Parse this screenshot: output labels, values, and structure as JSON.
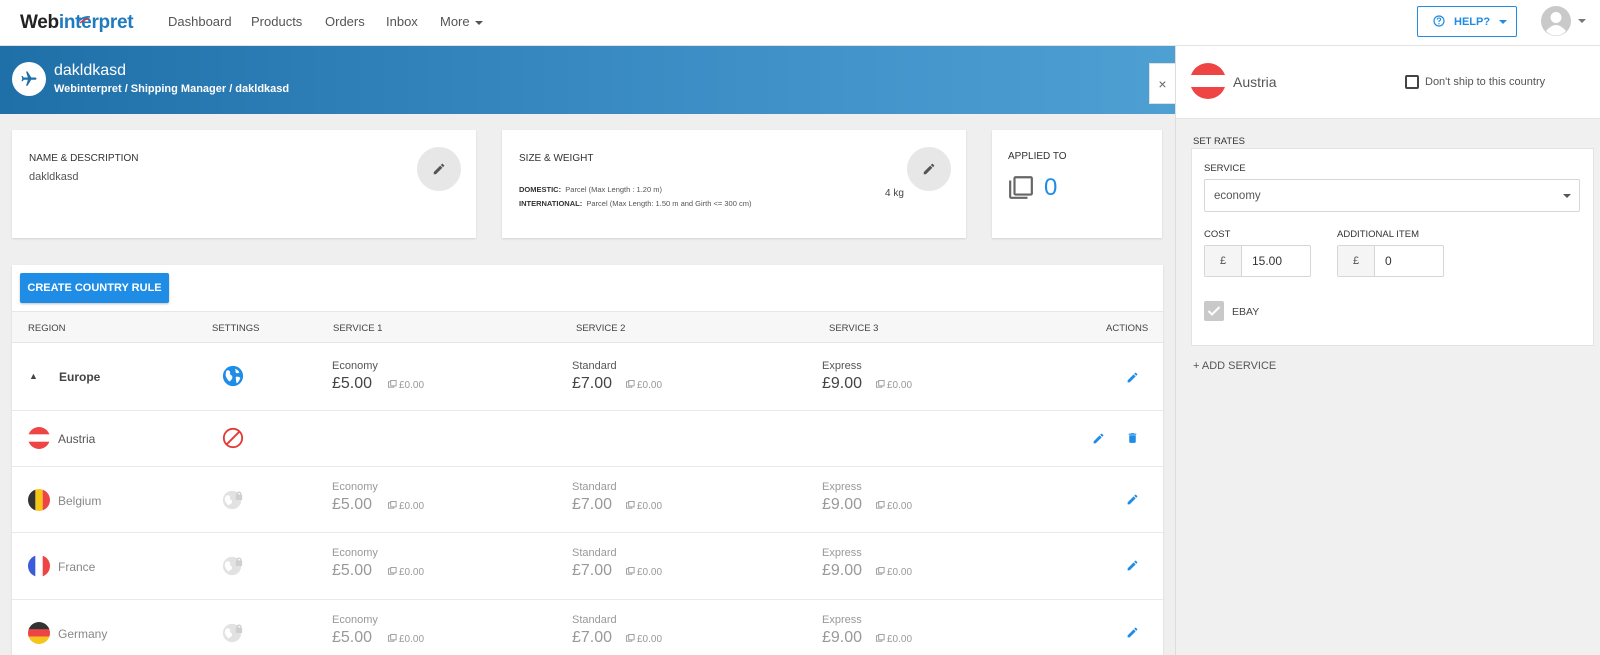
{
  "app": {
    "logo_main": "Web",
    "logo_accent": "interpret"
  },
  "nav": {
    "items": [
      {
        "label": "Dashboard"
      },
      {
        "label": "Products"
      },
      {
        "label": "Orders"
      },
      {
        "label": "Inbox"
      },
      {
        "label": "More"
      }
    ],
    "help_label": "HELP?"
  },
  "header": {
    "title": "dakldkasd",
    "breadcrumb": "Webinterpret / Shipping Manager / dakldkasd",
    "close_label": "×"
  },
  "cards": {
    "name": {
      "label": "NAME & DESCRIPTION",
      "value": "dakldkasd"
    },
    "size": {
      "label": "SIZE & WEIGHT",
      "domestic_label": "DOMESTIC:",
      "domestic_value": "Parcel (Max Length : 1.20 m)",
      "international_label": "INTERNATIONAL:",
      "international_value": "Parcel (Max Length: 1.50 m and Girth <= 300 cm)",
      "weight": "4 kg"
    },
    "applied": {
      "label": "APPLIED TO",
      "count": "0"
    }
  },
  "table": {
    "create_button": "CREATE COUNTRY RULE",
    "headers": {
      "region": "REGION",
      "settings": "SETTINGS",
      "service1": "SERVICE 1",
      "service2": "SERVICE 2",
      "service3": "SERVICE 3",
      "actions": "ACTIONS"
    },
    "toggle": "▲",
    "rows": [
      {
        "region": "Europe",
        "settings_icon": "globe-icon",
        "s1_name": "Economy",
        "s1_price": "£5.00",
        "s1_add": "£0.00",
        "s2_name": "Standard",
        "s2_price": "£7.00",
        "s2_add": "£0.00",
        "s3_name": "Express",
        "s3_price": "£9.00",
        "s3_add": "£0.00"
      },
      {
        "region": "Austria",
        "flag": "austria-flag-icon",
        "settings_icon": "no-shipping-icon"
      },
      {
        "region": "Belgium",
        "flag": "belgium-flag-icon",
        "settings_icon": "globe-lock-icon",
        "s1_name": "Economy",
        "s1_price": "£5.00",
        "s1_add": "£0.00",
        "s2_name": "Standard",
        "s2_price": "£7.00",
        "s2_add": "£0.00",
        "s3_name": "Express",
        "s3_price": "£9.00",
        "s3_add": "£0.00"
      },
      {
        "region": "France",
        "flag": "france-flag-icon",
        "settings_icon": "globe-lock-icon",
        "s1_name": "Economy",
        "s1_price": "£5.00",
        "s1_add": "£0.00",
        "s2_name": "Standard",
        "s2_price": "£7.00",
        "s2_add": "£0.00",
        "s3_name": "Express",
        "s3_price": "£9.00",
        "s3_add": "£0.00"
      },
      {
        "region": "Germany",
        "flag": "germany-flag-icon",
        "settings_icon": "globe-lock-icon",
        "s1_name": "Economy",
        "s1_price": "£5.00",
        "s1_add": "£0.00",
        "s2_name": "Standard",
        "s2_price": "£7.00",
        "s2_add": "£0.00",
        "s3_name": "Express",
        "s3_price": "£9.00",
        "s3_add": "£0.00"
      }
    ]
  },
  "panel": {
    "country": "Austria",
    "dont_ship_label": "Don't ship to this country",
    "dont_ship_checked": false,
    "set_rates_label": "SET RATES",
    "service_label": "SERVICE",
    "service_value": "economy",
    "cost_label": "COST",
    "cost_currency": "£",
    "cost_value": "15.00",
    "additional_label": "ADDITIONAL ITEM",
    "additional_currency": "£",
    "additional_value": "0",
    "ebay_label": "EBAY",
    "ebay_checked": true,
    "add_service_label": "+ ADD SERVICE"
  },
  "colors": {
    "accent": "#1f8ce6",
    "header_start": "#1f6fa8",
    "header_end": "#4ea0d3",
    "danger": "#e53935"
  }
}
